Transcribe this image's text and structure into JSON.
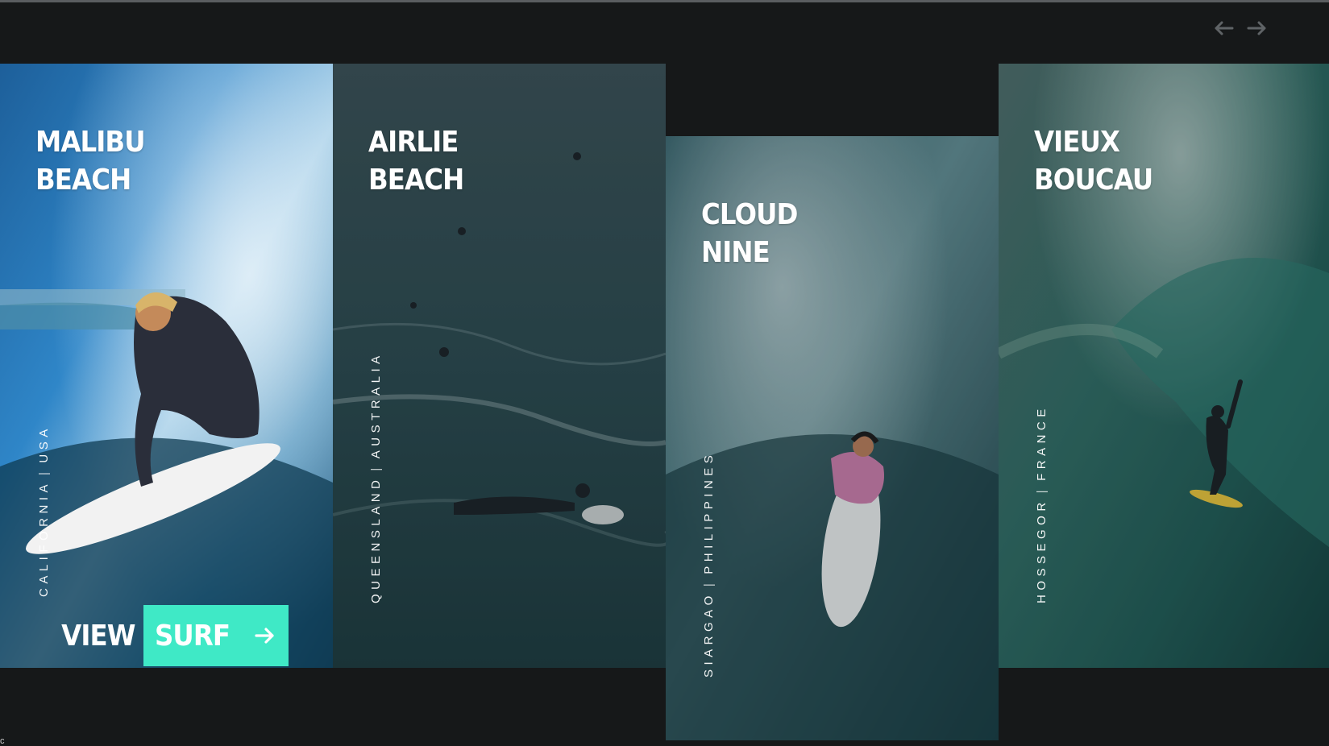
{
  "nav": {
    "prev_icon": "arrow-left-icon",
    "next_icon": "arrow-right-icon",
    "icon_color": "#5f6366"
  },
  "cards": [
    {
      "title": "MALIBU\nBEACH",
      "region": "CALIFORNIA",
      "country": "USA",
      "separator": "|",
      "active": true
    },
    {
      "title": "AIRLIE\nBEACH",
      "region": "QUEENSLAND",
      "country": "AUSTRALIA",
      "separator": "|",
      "active": false
    },
    {
      "title": "CLOUD\nNINE",
      "region": "SIARGAO",
      "country": "PHILIPPINES",
      "separator": "|",
      "active": false
    },
    {
      "title": "VIEUX\nBOUCAU",
      "region": "HOSSEGOR",
      "country": "FRANCE",
      "separator": "|",
      "active": false
    }
  ],
  "cta": {
    "view_label": "VIEW",
    "surf_label": "SURF",
    "arrow_icon": "arrow-right-icon",
    "accent_color": "#3fe9c6"
  },
  "footer_char": "c",
  "colors": {
    "background": "#161819",
    "text": "#ffffff"
  }
}
